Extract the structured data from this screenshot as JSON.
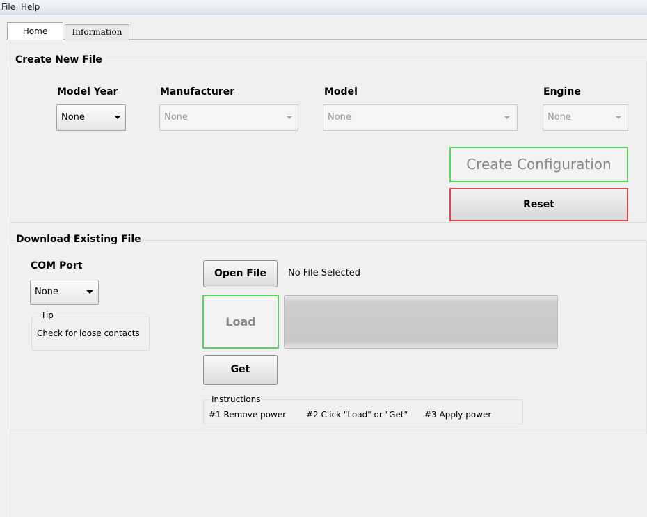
{
  "menu": {
    "file": "File",
    "help": "Help"
  },
  "tabs": [
    {
      "label": "Home",
      "active": true
    },
    {
      "label": "Information",
      "active": false
    }
  ],
  "create_new_file": {
    "title": "Create New File",
    "model_year": {
      "label": "Model Year",
      "value": "None"
    },
    "manufacturer": {
      "label": "Manufacturer",
      "value": "None"
    },
    "model": {
      "label": "Model",
      "value": "None"
    },
    "engine": {
      "label": "Engine",
      "value": "None"
    },
    "create_button": "Create Configuration",
    "reset_button": "Reset"
  },
  "download_existing_file": {
    "title": "Download Existing File",
    "com_port": {
      "label": "COM Port",
      "value": "None"
    },
    "tip": {
      "legend": "Tip",
      "text": "Check for loose contacts"
    },
    "open_file_button": "Open File",
    "file_status": "No File Selected",
    "load_button": "Load",
    "get_button": "Get",
    "instructions": {
      "legend": "Instructions",
      "step1": "#1 Remove power",
      "step2": "#2 Click \"Load\" or \"Get\"",
      "step3": "#3 Apply power"
    }
  },
  "colors": {
    "create_border": "#5fd35f",
    "reset_border": "#d94b4b",
    "load_border": "#5fd35f"
  }
}
